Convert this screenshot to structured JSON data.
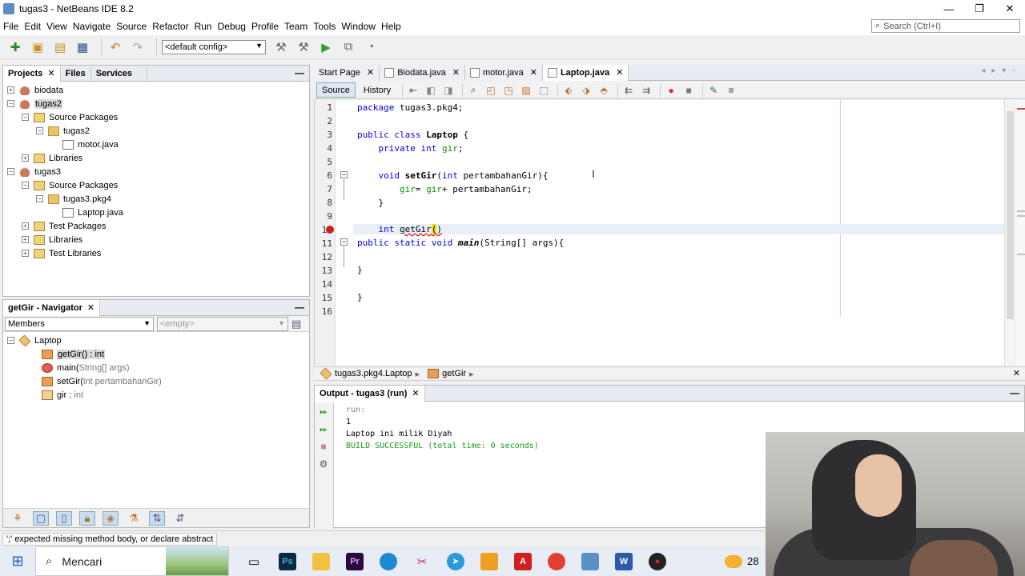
{
  "window": {
    "title": "tugas3 - NetBeans IDE 8.2",
    "controls": [
      "—",
      "❐",
      "✕"
    ]
  },
  "menu": [
    "File",
    "Edit",
    "View",
    "Navigate",
    "Source",
    "Refactor",
    "Run",
    "Debug",
    "Profile",
    "Team",
    "Tools",
    "Window",
    "Help"
  ],
  "search": {
    "placeholder": "Search (Ctrl+I)"
  },
  "toolbar": {
    "config": "<default config>"
  },
  "projects_panel": {
    "tabs": [
      "Projects",
      "Files",
      "Services"
    ],
    "tree": [
      {
        "level": 0,
        "exp": "+",
        "icon": "project-icon",
        "label": "biodata"
      },
      {
        "level": 0,
        "exp": "−",
        "icon": "project-icon",
        "label": "tugas2",
        "selected": true
      },
      {
        "level": 1,
        "exp": "−",
        "icon": "source-packages-icon",
        "label": "Source Packages"
      },
      {
        "level": 2,
        "exp": "−",
        "icon": "package-icon",
        "label": "tugas2"
      },
      {
        "level": 3,
        "exp": "",
        "icon": "java-file-icon",
        "label": "motor.java"
      },
      {
        "level": 1,
        "exp": "+",
        "icon": "libraries-icon",
        "label": "Libraries"
      },
      {
        "level": 0,
        "exp": "−",
        "icon": "project-icon",
        "label": "tugas3"
      },
      {
        "level": 1,
        "exp": "−",
        "icon": "source-packages-icon",
        "label": "Source Packages"
      },
      {
        "level": 2,
        "exp": "−",
        "icon": "package-icon",
        "label": "tugas3.pkg4"
      },
      {
        "level": 3,
        "exp": "",
        "icon": "java-file-icon",
        "label": "Laptop.java"
      },
      {
        "level": 1,
        "exp": "+",
        "icon": "test-packages-icon",
        "label": "Test Packages"
      },
      {
        "level": 1,
        "exp": "+",
        "icon": "libraries-icon",
        "label": "Libraries"
      },
      {
        "level": 1,
        "exp": "+",
        "icon": "test-libraries-icon",
        "label": "Test Libraries"
      }
    ]
  },
  "navigator": {
    "title": "getGir - Navigator",
    "filter": "Members",
    "filter2": "<empty>",
    "tree": [
      {
        "level": 0,
        "exp": "−",
        "icon": "class-icon",
        "name": "Laptop",
        "sig": ""
      },
      {
        "level": 1,
        "exp": "",
        "icon": "method-icon",
        "name": "getGir() : int",
        "sig": "",
        "selected": true
      },
      {
        "level": 1,
        "exp": "",
        "icon": "static-method-icon",
        "name": "main(",
        "sig": "String[] args)"
      },
      {
        "level": 1,
        "exp": "",
        "icon": "method-icon",
        "name": "setGir(",
        "sig": "int pertambahanGir)"
      },
      {
        "level": 1,
        "exp": "",
        "icon": "field-icon",
        "name": "gir : ",
        "sig": "int"
      }
    ]
  },
  "editor": {
    "tabs": [
      {
        "label": "Start Page",
        "active": false
      },
      {
        "label": "Biodata.java",
        "active": false
      },
      {
        "label": "motor.java",
        "active": false
      },
      {
        "label": "Laptop.java",
        "active": true
      }
    ],
    "modes": [
      "Source",
      "History"
    ],
    "line_numbers": [
      "1",
      "2",
      "3",
      "4",
      "5",
      "6",
      "7",
      "8",
      "9",
      "10",
      "11",
      "12",
      "13",
      "14",
      "15",
      "16"
    ],
    "code": {
      "l1_kw": "package",
      "l1_rest": " tugas3.pkg4;",
      "l3_kw1": "public",
      "l3_kw2": "class",
      "l3_name": "Laptop",
      "l3_rest": " {",
      "l4_kw": "private int",
      "l4_field": "gir",
      "l4_rest": ";",
      "l6_kw": "void",
      "l6_name": "setGir",
      "l6_rest1": "(",
      "l6_kw2": "int",
      "l6_rest2": " pertambahanGir){",
      "l7_f1": "gir",
      "l7_mid": "= ",
      "l7_f2": "gir",
      "l7_rest": "+ pertambahanGir;",
      "l8": "}",
      "l10_kw": "int",
      "l10_name": "getGir",
      "l10_caret": "(",
      "l10_paren": ")",
      "l11_kw": "public static void",
      "l11_name": "main",
      "l11_rest": "(String[] args){",
      "l13": "}",
      "l15": "}"
    },
    "breadcrumb": [
      "tugas3.pkg4.Laptop",
      "getGir"
    ]
  },
  "output": {
    "title": "Output - tugas3 (run)",
    "lines": [
      "run:",
      "1",
      "Laptop ini milik Diyah",
      "BUILD SUCCESSFUL (total time: 0 seconds)"
    ]
  },
  "status": {
    "message": "';' expected  missing method body, or declare abstract"
  },
  "taskbar": {
    "search": "Mencari",
    "weather": "28"
  }
}
